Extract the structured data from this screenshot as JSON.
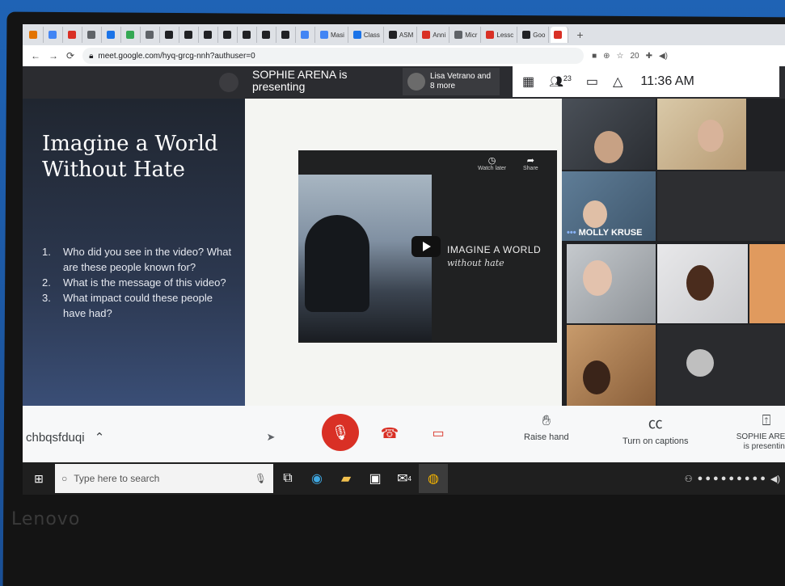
{
  "browser": {
    "tabs": [
      "",
      "",
      "",
      "",
      "",
      "",
      "",
      "",
      "",
      "",
      "",
      "",
      "",
      "",
      "",
      "Masi",
      "Class",
      "ASM",
      "Anni",
      "Micr",
      "Lessc",
      "Goo",
      ""
    ],
    "url": "meet.google.com/hyq-grcg-nnh?authuser=0",
    "ext_badge": "20"
  },
  "meet": {
    "presenter_label": "SOPHIE ARENA is presenting",
    "others_label": "Lisa Vetrano and 8 more",
    "participant_count": "23",
    "time": "11:36 AM",
    "meeting_code": "chbqsfduqi",
    "raise_hand": "Raise hand",
    "captions": "Turn on captions",
    "presenting_status": "SOPHIE ARENA is presenting",
    "tile_name": "MOLLY KRUSE"
  },
  "slide": {
    "title": "Imagine a World Without Hate",
    "questions": [
      {
        "n": "1.",
        "text": "Who did you see in the video? What are these people known for?"
      },
      {
        "n": "2.",
        "text": "What is the message of this video?"
      },
      {
        "n": "3.",
        "text": "What impact could these people have had?"
      }
    ],
    "video_title": "IMAGINE A WORLD",
    "video_subtitle": "without hate",
    "watch_later": "Watch later",
    "share": "Share"
  },
  "taskbar": {
    "search_placeholder": "Type here to search",
    "mail_badge": "4"
  },
  "device": {
    "brand": "Lenovo"
  },
  "colors": {
    "meet_red": "#d93025",
    "slide_gradient_bottom": "#3a4e76"
  }
}
